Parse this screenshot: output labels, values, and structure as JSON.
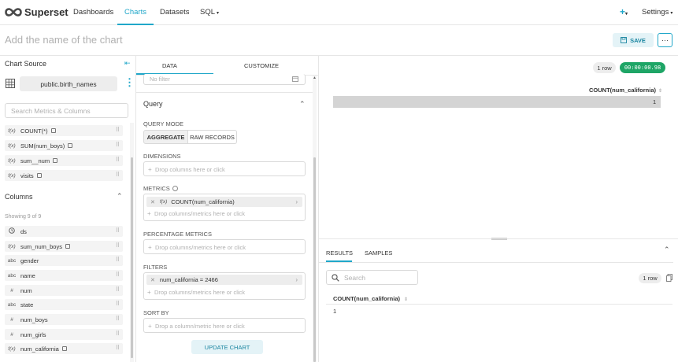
{
  "nav": {
    "brand": "Superset",
    "items": [
      "Dashboards",
      "Charts",
      "Datasets",
      "SQL"
    ],
    "settings": "Settings"
  },
  "header": {
    "chart_name_placeholder": "Add the name of the chart",
    "save_label": "SAVE",
    "more_label": "···"
  },
  "left": {
    "chart_source": "Chart Source",
    "dataset": "public.birth_names",
    "search_placeholder": "Search Metrics & Columns",
    "metrics": [
      {
        "type": "f(x)",
        "name": "COUNT(*)"
      },
      {
        "type": "f(x)",
        "name": "SUM(num_boys)"
      },
      {
        "type": "f(x)",
        "name": "sum__num"
      },
      {
        "type": "f(x)",
        "name": "visits"
      }
    ],
    "columns_title": "Columns",
    "showing": "Showing 9 of 9",
    "columns": [
      {
        "type": "clock",
        "name": "ds"
      },
      {
        "type": "f(x)",
        "name": "sum_num_boys"
      },
      {
        "type": "abc",
        "name": "gender"
      },
      {
        "type": "abc",
        "name": "name"
      },
      {
        "type": "#",
        "name": "num"
      },
      {
        "type": "abc",
        "name": "state"
      },
      {
        "type": "#",
        "name": "num_boys"
      },
      {
        "type": "#",
        "name": "num_girls"
      },
      {
        "type": "f(x)",
        "name": "num_california"
      }
    ]
  },
  "middle": {
    "tabs": [
      "DATA",
      "CUSTOMIZE"
    ],
    "no_filter": "No filter",
    "query_title": "Query",
    "query_mode_label": "QUERY MODE",
    "modes": [
      "AGGREGATE",
      "RAW RECORDS"
    ],
    "dimensions_label": "DIMENSIONS",
    "drop_columns": "Drop columns here or click",
    "metrics_label": "METRICS",
    "metric_chip": "COUNT(num_california)",
    "drop_columns_metrics": "Drop columns/metrics here or click",
    "percentage_label": "PERCENTAGE METRICS",
    "filters_label": "FILTERS",
    "filter_chip": "num_california = 2466",
    "sort_by_label": "SORT BY",
    "drop_column_metric": "Drop a column/metric here or click",
    "update_label": "UPDATE CHART"
  },
  "right": {
    "row_count": "1 row",
    "timer": "00:00:00.98",
    "table_header": "COUNT(num_california)",
    "table_value": "1",
    "tabs": [
      "RESULTS",
      "SAMPLES"
    ],
    "search_placeholder": "Search",
    "results_rows": "1 row",
    "results_header": "COUNT(num_california)",
    "results_value": "1"
  }
}
